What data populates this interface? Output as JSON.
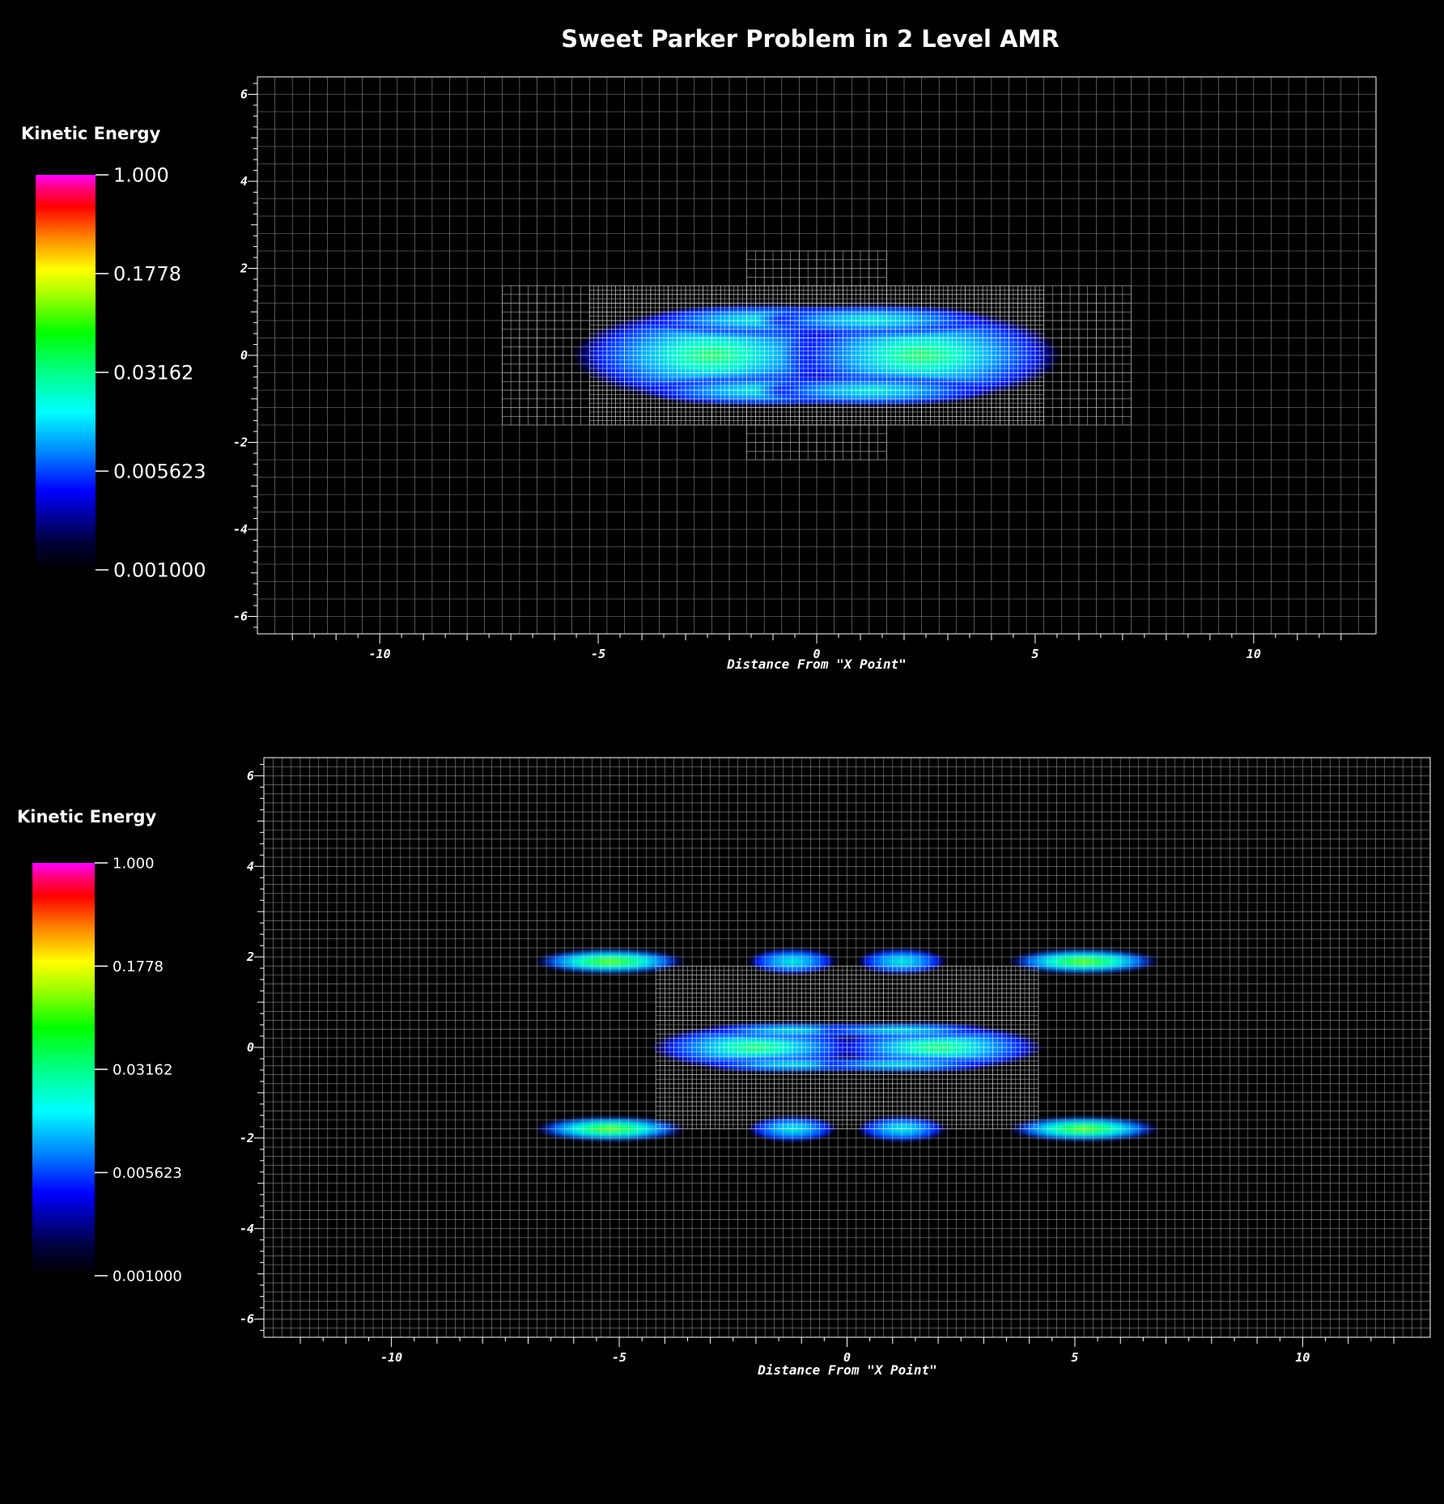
{
  "chart_data": [
    {
      "type": "heatmap",
      "title": "Sweet Parker Problem in 2 Level AMR",
      "xlabel": "Distance From \"X Point\"",
      "ylabel": "",
      "xlim": [
        -12.8,
        12.8
      ],
      "ylim": [
        -6.4,
        6.4
      ],
      "x_ticks": [
        "-10",
        "-5",
        "0",
        "5",
        "10"
      ],
      "y_ticks": [
        "6",
        "4",
        "2",
        "0",
        "-2",
        "-4",
        "-6"
      ],
      "grid": true,
      "colorbar": {
        "title": "Kinetic Energy",
        "scale": "log",
        "labels": [
          "1.000",
          "0.1778",
          "0.03162",
          "0.005623",
          "0.001000"
        ],
        "range": [
          0.001,
          1.0
        ]
      },
      "amr_levels": [
        {
          "level": 0,
          "cell_size": 0.4,
          "extent": [
            [
              -12.8,
              12.8
            ],
            [
              -6.4,
              6.4
            ]
          ]
        },
        {
          "level": 1,
          "cell_size": 0.2,
          "extent": [
            [
              -7.2,
              7.2
            ],
            [
              -1.6,
              1.6
            ]
          ]
        },
        {
          "level": 2,
          "cell_size": 0.1,
          "extent": [
            [
              -5.2,
              5.2
            ],
            [
              -1.6,
              1.6
            ]
          ]
        },
        {
          "level": 1,
          "cell_size": 0.2,
          "extent": [
            [
              -1.6,
              1.6
            ],
            [
              1.6,
              2.4
            ]
          ]
        },
        {
          "level": 1,
          "cell_size": 0.2,
          "extent": [
            [
              -1.6,
              1.6
            ],
            [
              -2.4,
              -1.6
            ]
          ]
        }
      ],
      "features": [
        {
          "name": "left lobe",
          "x": -2.4,
          "y": 0.0,
          "peak_kinetic_energy": 0.03162
        },
        {
          "name": "right lobe",
          "x": 2.4,
          "y": 0.0,
          "peak_kinetic_energy": 0.03162
        }
      ]
    },
    {
      "type": "heatmap",
      "title": "",
      "xlabel": "Distance From \"X Point\"",
      "ylabel": "",
      "xlim": [
        -12.8,
        12.8
      ],
      "ylim": [
        -6.4,
        6.4
      ],
      "x_ticks": [
        "-10",
        "-5",
        "0",
        "5",
        "10"
      ],
      "y_ticks": [
        "6",
        "4",
        "2",
        "0",
        "-2",
        "-4",
        "-6"
      ],
      "grid": true,
      "colorbar": {
        "title": "Kinetic Energy",
        "scale": "log",
        "labels": [
          "1.000",
          "0.1778",
          "0.03162",
          "0.005623",
          "0.001000"
        ],
        "range": [
          0.001,
          1.0
        ]
      },
      "amr_levels": [
        {
          "level": 0,
          "cell_size": 0.2,
          "extent": [
            [
              -12.8,
              12.8
            ],
            [
              -6.4,
              6.4
            ]
          ]
        },
        {
          "level": 1,
          "cell_size": 0.1,
          "extent": [
            [
              -4.2,
              4.2
            ],
            [
              -1.8,
              1.8
            ]
          ]
        }
      ],
      "features": [
        {
          "name": "central left lobe",
          "x": -2.0,
          "y": 0.0,
          "peak_kinetic_energy": 0.03162
        },
        {
          "name": "central right lobe",
          "x": 2.0,
          "y": 0.0,
          "peak_kinetic_energy": 0.03162
        },
        {
          "name": "upper outer left",
          "x": -5.2,
          "y": 1.9,
          "peak_kinetic_energy": 0.05
        },
        {
          "name": "upper inner left",
          "x": -1.2,
          "y": 1.9,
          "peak_kinetic_energy": 0.01
        },
        {
          "name": "upper inner right",
          "x": 1.2,
          "y": 1.9,
          "peak_kinetic_energy": 0.01
        },
        {
          "name": "upper outer right",
          "x": 5.2,
          "y": 1.9,
          "peak_kinetic_energy": 0.05
        },
        {
          "name": "lower outer left",
          "x": -5.2,
          "y": -1.8,
          "peak_kinetic_energy": 0.05
        },
        {
          "name": "lower inner left",
          "x": -1.2,
          "y": -1.8,
          "peak_kinetic_energy": 0.01
        },
        {
          "name": "lower inner right",
          "x": 1.2,
          "y": -1.8,
          "peak_kinetic_energy": 0.01
        },
        {
          "name": "lower outer right",
          "x": 5.2,
          "y": -1.8,
          "peak_kinetic_energy": 0.05
        }
      ]
    }
  ]
}
